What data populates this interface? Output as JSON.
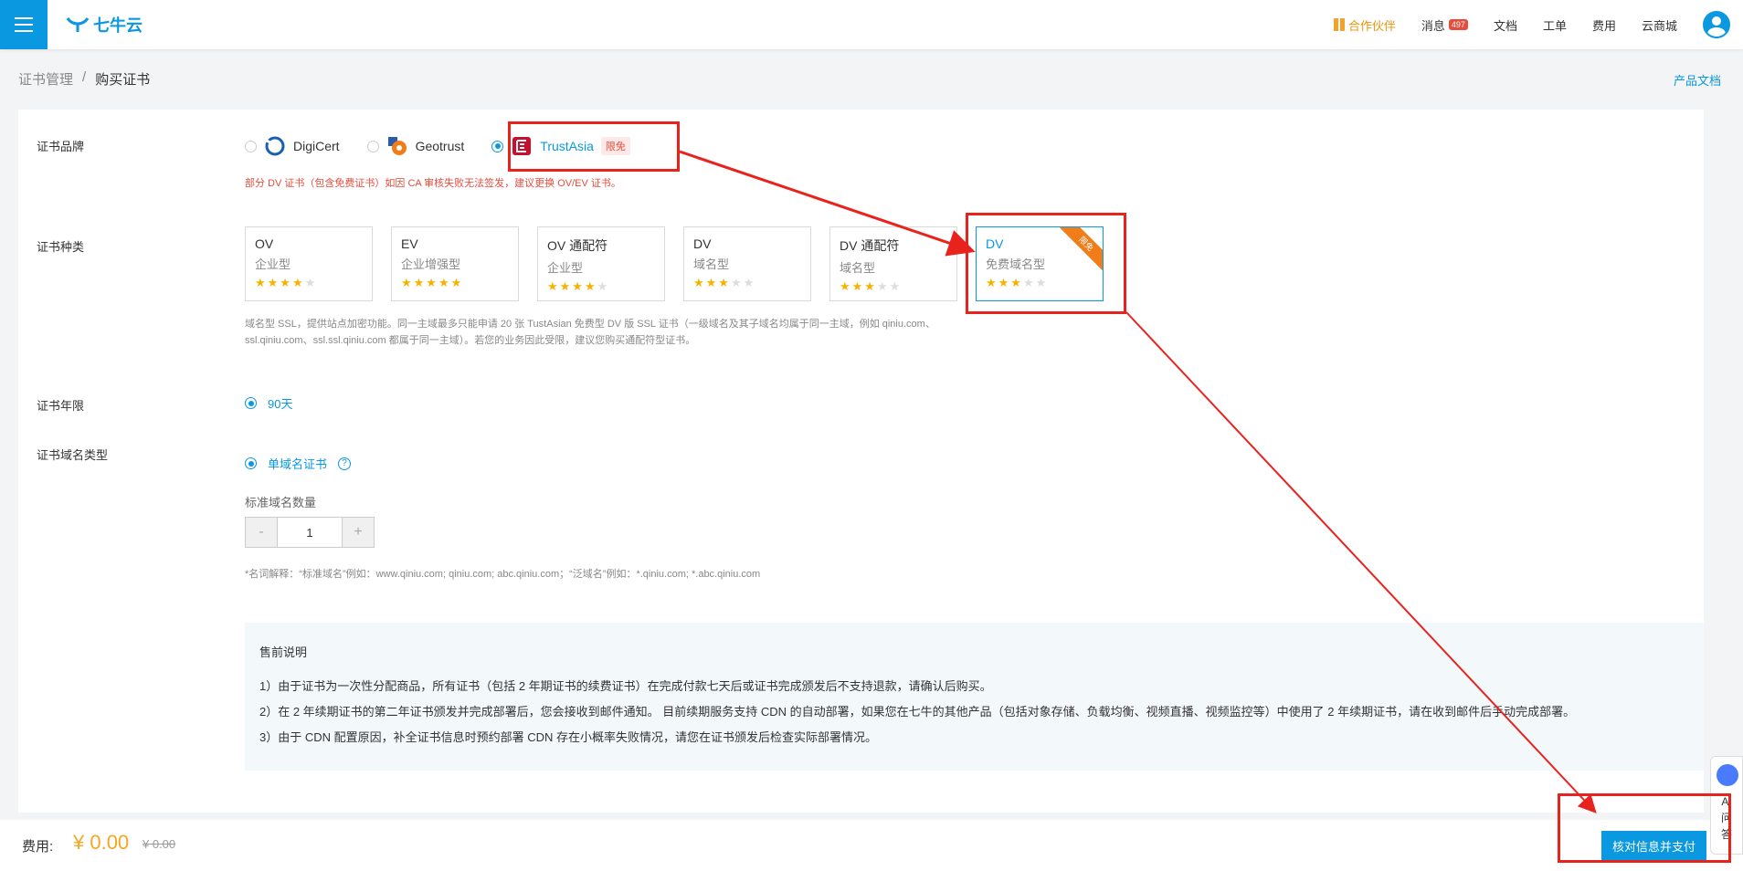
{
  "header": {
    "logo_text": "七牛云",
    "nav": [
      {
        "label": "合作伙伴"
      },
      {
        "label": "消息",
        "badge": "497"
      },
      {
        "label": "文档"
      },
      {
        "label": "工单"
      },
      {
        "label": "费用"
      },
      {
        "label": "云商城"
      }
    ]
  },
  "breadcrumb": {
    "parent": "证书管理",
    "sep": "/",
    "current": "购买证书"
  },
  "doc_link": "产品文档",
  "form": {
    "brand_label": "证书品牌",
    "brands": [
      {
        "name": "DigiCert",
        "selected": false
      },
      {
        "name": "Geotrust",
        "selected": false
      },
      {
        "name": "TrustAsia",
        "selected": true,
        "tag": "限免"
      }
    ],
    "brand_warning": "部分 DV 证书（包含免费证书）如因 CA 审核失败无法签发，建议更换 OV/EV 证书。",
    "type_label": "证书种类",
    "types": [
      {
        "name": "OV",
        "sub": "企业型",
        "rating": 4
      },
      {
        "name": "EV",
        "sub": "企业增强型",
        "rating": 4.5
      },
      {
        "name": "OV 通配符",
        "sub": "企业型",
        "rating": 4
      },
      {
        "name": "DV",
        "sub": "域名型",
        "rating": 2.5
      },
      {
        "name": "DV 通配符",
        "sub": "域名型",
        "rating": 2.5
      },
      {
        "name": "DV",
        "sub": "免费域名型",
        "rating": 2.5,
        "active": true,
        "ribbon": "限免"
      }
    ],
    "type_desc_1": "域名型 SSL，提供站点加密功能。同一主域最多只能申请 20 张 TustAsian 免费型 DV 版 SSL 证书（一级域名及其子域名均属于同一主域，例如 qiniu.com、",
    "type_desc_2": "ssl.qiniu.com、ssl.ssl.qiniu.com 都属于同一主域）。若您的业务因此受限，建议您购买通配符型证书。",
    "year_label": "证书年限",
    "year_value": "90天",
    "domain_type_label": "证书域名类型",
    "domain_type_value": "单域名证书",
    "qty_label": "标准域名数量",
    "qty_minus": "-",
    "qty_value": "1",
    "qty_plus": "+",
    "note": "*名词解释：“标准域名”例如：www.qiniu.com; qiniu.com; abc.qiniu.com；“泛域名”例如：*.qiniu.com; *.abc.qiniu.com"
  },
  "presale": {
    "title": "售前说明",
    "items": [
      "1）由于证书为一次性分配商品，所有证书（包括 2 年期证书的续费证书）在完成付款七天后或证书完成颁发后不支持退款，请确认后购买。",
      "2）在 2 年续期证书的第二年证书颁发并完成部署后，您会接收到邮件通知。 目前续期服务支持 CDN 的自动部署，如果您在七牛的其他产品（包括对象存储、负载均衡、视频直播、视频监控等）中使用了 2 年续期证书，请在收到邮件后手动完成部署。",
      "3）由于 CDN 配置原因，补全证书信息时预约部署 CDN 存在小概率失败情况，请您在证书颁发后检查实际部署情况。"
    ]
  },
  "footer": {
    "fee_label": "费用:",
    "fee_value": "¥ 0.00",
    "fee_original": "¥ 0.00",
    "pay_button": "核对信息并支付"
  },
  "ai_widget": {
    "label_1": "AI",
    "label_2": "问",
    "label_3": "答"
  },
  "colors": {
    "primary": "#0a98e0",
    "annotation": "#e8231e",
    "price": "#f5a623"
  }
}
